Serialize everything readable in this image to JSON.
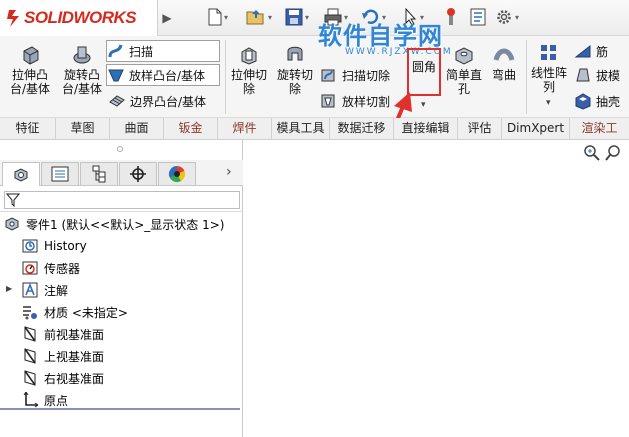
{
  "app": {
    "logo": "SOLIDWORKS",
    "colors": {
      "brand_red": "#d52b1e",
      "accent_blue": "#2f86d6",
      "highlight_red": "#e0312f"
    }
  },
  "watermark": {
    "text": "软件自学网",
    "url": "WWW.RJZXW.COM"
  },
  "quick_access": [
    "new-document-icon",
    "open-icon",
    "save-icon",
    "print-icon",
    "undo-icon",
    "select-icon",
    "rebuild-icon",
    "file-properties-icon",
    "options-gear-icon"
  ],
  "ribbon": {
    "extrude_boss": "拉伸凸台/基体",
    "revolve_boss": "旋转凸台/基体",
    "sweep": "扫描",
    "loft_boss": "放样凸台/基体",
    "boundary_boss": "边界凸台/基体",
    "extrude_cut": "拉伸切除",
    "revolve_cut": "旋转切除",
    "sweep_cut": "扫描切除",
    "loft_cut": "放样切割",
    "fillet": "圆角",
    "simple_hole": "简单直孔",
    "flex": "弯曲",
    "linear_pattern": "线性阵列",
    "rib": "筋",
    "draft": "拔模",
    "shell": "抽壳"
  },
  "tabs": [
    {
      "label": "特征",
      "active": true
    },
    {
      "label": "草图"
    },
    {
      "label": "曲面"
    },
    {
      "label": "钣金",
      "dim": true
    },
    {
      "label": "焊件",
      "dim": true
    },
    {
      "label": "模具工具"
    },
    {
      "label": "数据迁移"
    },
    {
      "label": "直接编辑"
    },
    {
      "label": "评估"
    },
    {
      "label": "DimXpert"
    },
    {
      "label": "渲染工",
      "dim": true
    }
  ],
  "tree": {
    "root": "零件1  (默认<<默认>_显示状态 1>)",
    "items": [
      {
        "label": "History",
        "icon": "history-icon"
      },
      {
        "label": "传感器",
        "icon": "sensor-icon"
      },
      {
        "label": "注解",
        "icon": "annotation-icon",
        "expandable": true
      },
      {
        "label": "材质 <未指定>",
        "icon": "material-icon"
      },
      {
        "label": "前视基准面",
        "icon": "plane-icon"
      },
      {
        "label": "上视基准面",
        "icon": "plane-icon"
      },
      {
        "label": "右视基准面",
        "icon": "plane-icon"
      },
      {
        "label": "原点",
        "icon": "origin-icon"
      }
    ]
  }
}
